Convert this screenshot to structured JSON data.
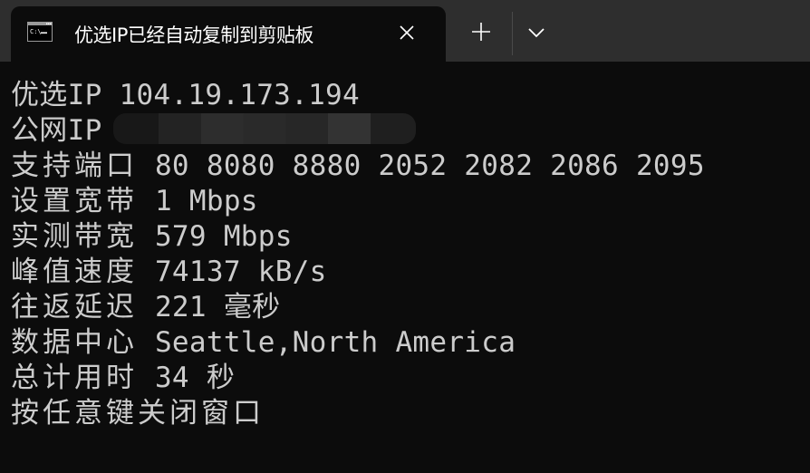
{
  "window": {
    "tab": {
      "icon": "command-prompt-icon",
      "title": "优选IP已经自动复制到剪贴板",
      "close_icon": "close-icon"
    },
    "new_tab_icon": "plus-icon",
    "dropdown_icon": "chevron-down-icon"
  },
  "terminal": {
    "lines": [
      {
        "label": "优选IP",
        "value": " 104.19.173.194"
      },
      {
        "label": "公网IP",
        "value": "",
        "redacted": true
      },
      {
        "label": "支持端口",
        "value": " 80 8080 8880 2052 2082 2086 2095"
      },
      {
        "label": "设置宽带",
        "value": " 1 Mbps"
      },
      {
        "label": "实测带宽",
        "value": " 579 Mbps"
      },
      {
        "label": "峰值速度",
        "value": " 74137 kB/s"
      },
      {
        "label": "往返延迟",
        "value": " 221 毫秒"
      },
      {
        "label": "数据中心",
        "value": " Seattle,North America"
      },
      {
        "label": "总计用时",
        "value": " 34 秒"
      },
      {
        "label": "按任意键关闭窗口",
        "value": ""
      }
    ]
  },
  "colors": {
    "background": "#0c0c0c",
    "tabbar": "#2e2e2e",
    "text": "#cccccc"
  }
}
